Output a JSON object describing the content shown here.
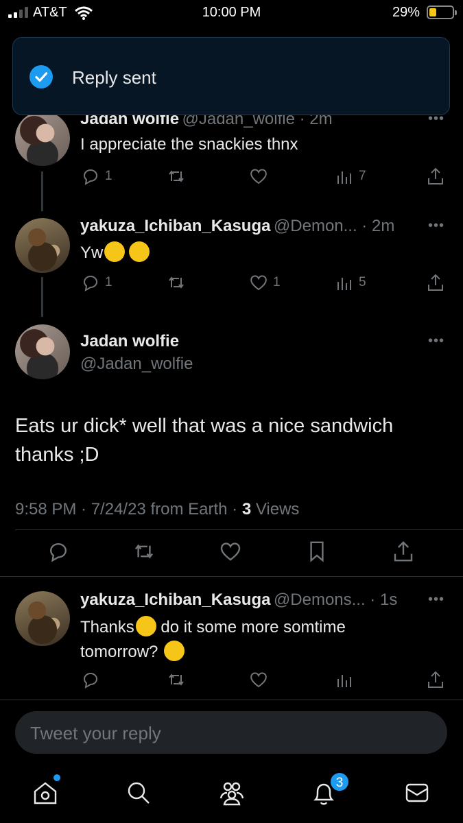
{
  "status_bar": {
    "carrier": "AT&T",
    "time": "10:00 PM",
    "battery": "29%"
  },
  "toast": {
    "label": "Reply sent"
  },
  "tweets": [
    {
      "name": "Jadan wolfie",
      "handle": "@Jadan_wolfie · 2m",
      "text": "I appreciate the snackies thnx",
      "replies": "1",
      "retweets": "",
      "likes": "",
      "views": "7"
    },
    {
      "name": "yakuza_Ichiban_Kasuga",
      "handle": "@Demon... · 2m",
      "text": "Yw",
      "replies": "1",
      "retweets": "",
      "likes": "1",
      "views": "5"
    },
    {
      "name": "yakuza_Ichiban_Kasuga",
      "handle": "@Demons... · 1s",
      "text_line1": "Thanks",
      "text_line1b": "do it some more somtime",
      "text_line2": "tomorrow?"
    }
  ],
  "main_tweet": {
    "name": "Jadan wolfie",
    "handle": "@Jadan_wolfie",
    "text_line1": "Eats ur dick* well that was a nice sandwich",
    "text_line2": "thanks ;D",
    "meta": "9:58 PM · 7/24/23 from Earth · ",
    "views_count": "3",
    "views_label": " Views"
  },
  "reply_box": {
    "placeholder": "Tweet your reply"
  },
  "nav": {
    "notifications_badge": "3"
  },
  "colors": {
    "accent": "#1d9bf0",
    "muted": "#71767b",
    "text": "#e7e9ea"
  }
}
